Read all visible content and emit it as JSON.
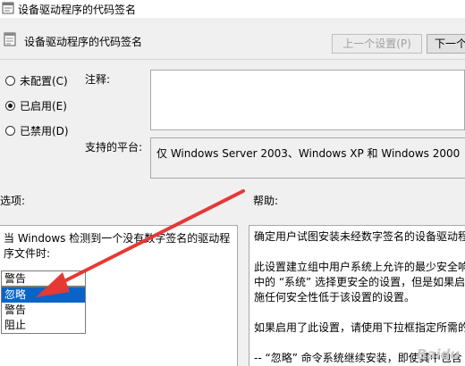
{
  "window": {
    "title": "设备驱动程序的代码签名"
  },
  "header": {
    "policy_title": "设备驱动程序的代码签名"
  },
  "nav": {
    "prev_label": "上一个设置(P)",
    "next_label": "下一个"
  },
  "state": {
    "options": [
      {
        "label": "未配置(C)",
        "checked": false
      },
      {
        "label": "已启用(E)",
        "checked": true
      },
      {
        "label": "已禁用(D)",
        "checked": false
      }
    ]
  },
  "comment": {
    "label": "注释:",
    "value": ""
  },
  "platform": {
    "label": "支持的平台:",
    "value": "仅 Windows Server 2003、Windows XP 和 Windows 2000"
  },
  "options_section": {
    "label": "选项:",
    "description": "当 Windows 检测到一个没有数字签名的驱动程序文件时:",
    "select": {
      "value": "警告",
      "items": [
        {
          "label": "忽略",
          "selected": true
        },
        {
          "label": "警告",
          "selected": false
        },
        {
          "label": "阻止",
          "selected": false
        }
      ]
    }
  },
  "help_section": {
    "label": "帮助:",
    "paragraphs": [
      "确定用户试图安装未经数字签名的设备驱动程",
      "此设置建立组中用户系统上允许的最少安全响应\n中的 “系统” 选择更安全的设置，但是如果启\n施任何安全性低于该设置的设置。",
      "如果启用了此设置，请使用下拉框指定所需的",
      "-- “忽略” 命令系统继续安装，即使其中包含"
    ]
  },
  "watermark": {
    "text": "Baidu"
  },
  "colors": {
    "selection": "#0a64c8",
    "annotation_arrow": "#e53935"
  }
}
